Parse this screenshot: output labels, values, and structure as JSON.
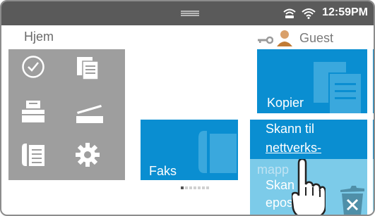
{
  "statusbar": {
    "time": "12:59PM",
    "icons": [
      "network-icon",
      "wifi-icon"
    ]
  },
  "home": {
    "title": "Hjem"
  },
  "user": {
    "label": "Guest",
    "icons": [
      "key-icon",
      "person-icon"
    ]
  },
  "apps_panel": {
    "icons": [
      "clock-icon",
      "documents-icon",
      "printer-icon",
      "scanner-icon",
      "fax-phone-icon",
      "settings-gear-icon"
    ]
  },
  "tiles": {
    "faks": "Faks",
    "kopier": "Kopier",
    "skann_nett_line1": "Skann til",
    "skann_nett_line2": "nettverks-",
    "skann_nett_line3": "mapp",
    "skann_epost_line1": "Skan",
    "skann_epost_line2": "epos"
  },
  "pagination": {
    "total": 7,
    "active": 0
  },
  "colors": {
    "statusbar": "#5a5a5a",
    "tile_blue": "#0a8ed1",
    "tile_faded": "#7ccbe9",
    "panel_gray": "#9e9e9e"
  }
}
